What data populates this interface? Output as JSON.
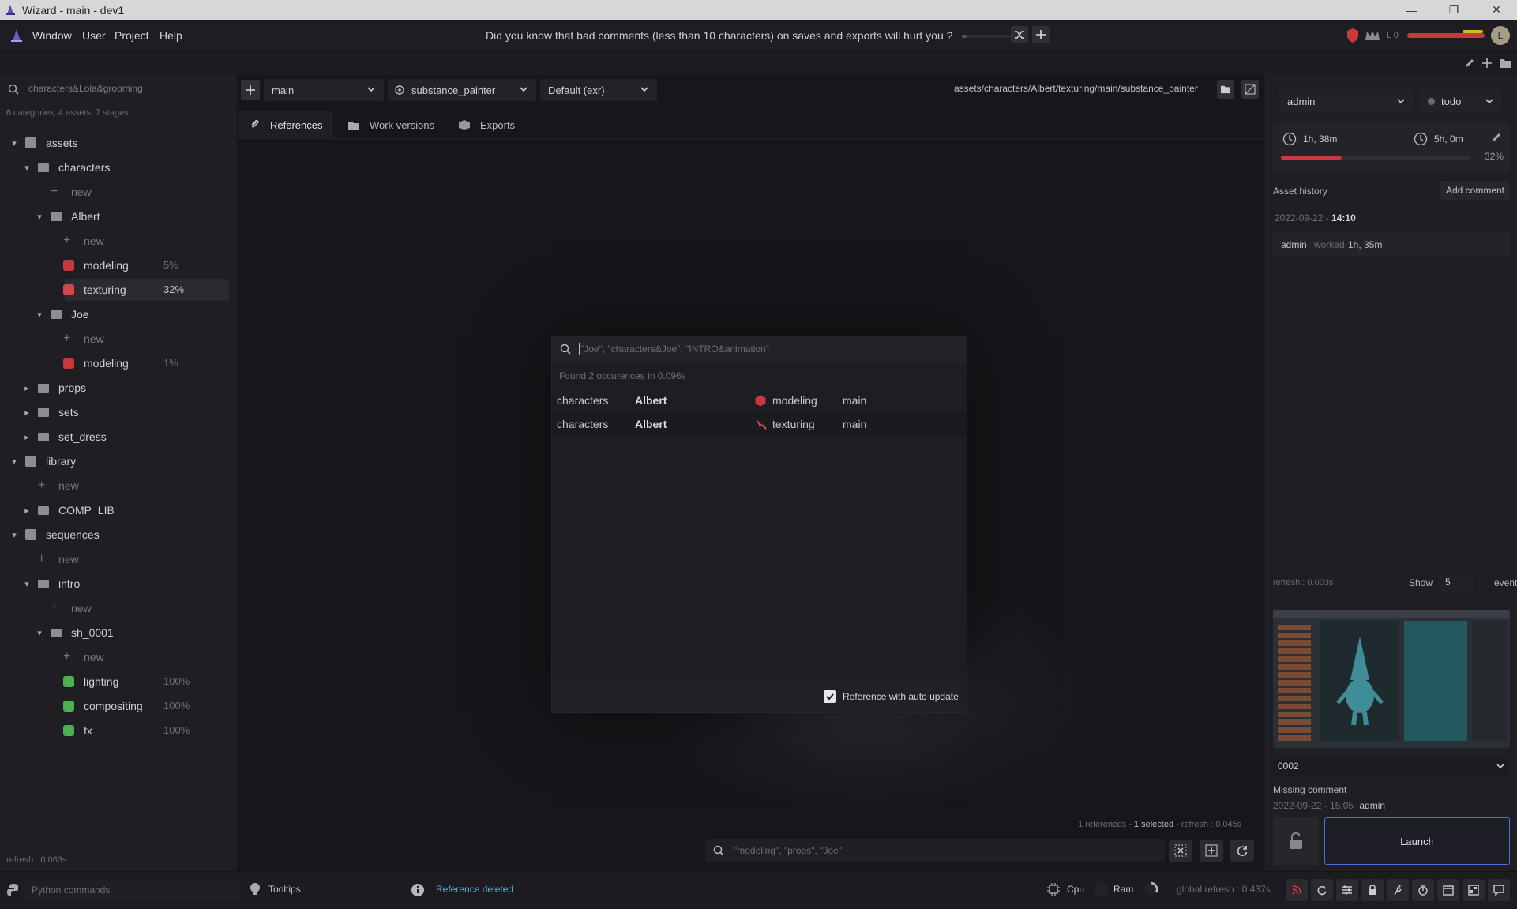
{
  "window": {
    "title": "Wizard - main - dev1",
    "minimize": "—",
    "maximize": "❐",
    "close": "✕"
  },
  "menu": {
    "items": [
      "Window",
      "User",
      "Project",
      "Help"
    ],
    "tip": "Did you know that bad comments (less than 10 characters) on saves and exports will hurt you ?",
    "level_label": "L 0",
    "avatar_letter": "L"
  },
  "left": {
    "search_value": "characters&Lola&grooming",
    "summary": "6 categories, 4 assets, 7 stages",
    "refresh": "refresh : 0.063s",
    "tree": [
      {
        "label": "assets",
        "depth": 0,
        "kind": "category",
        "open": true
      },
      {
        "label": "characters",
        "depth": 1,
        "kind": "folder",
        "open": true
      },
      {
        "label": "new",
        "depth": 2,
        "kind": "new"
      },
      {
        "label": "Albert",
        "depth": 2,
        "kind": "folder",
        "open": true
      },
      {
        "label": "new",
        "depth": 3,
        "kind": "new"
      },
      {
        "label": "modeling",
        "depth": 3,
        "kind": "stage",
        "pct": "5%",
        "color": "#c8383c"
      },
      {
        "label": "texturing",
        "depth": 3,
        "kind": "stage",
        "pct": "32%",
        "color": "#d0484a",
        "selected": true
      },
      {
        "label": "Joe",
        "depth": 2,
        "kind": "folder",
        "open": true
      },
      {
        "label": "new",
        "depth": 3,
        "kind": "new"
      },
      {
        "label": "modeling",
        "depth": 3,
        "kind": "stage",
        "pct": "1%",
        "color": "#c8383c"
      },
      {
        "label": "props",
        "depth": 1,
        "kind": "folder",
        "open": false
      },
      {
        "label": "sets",
        "depth": 1,
        "kind": "folder",
        "open": false
      },
      {
        "label": "set_dress",
        "depth": 1,
        "kind": "folder",
        "open": false
      },
      {
        "label": "library",
        "depth": 0,
        "kind": "category",
        "open": true
      },
      {
        "label": "new",
        "depth": 1,
        "kind": "new"
      },
      {
        "label": "COMP_LIB",
        "depth": 1,
        "kind": "folder",
        "open": false
      },
      {
        "label": "sequences",
        "depth": 0,
        "kind": "category",
        "open": true
      },
      {
        "label": "new",
        "depth": 1,
        "kind": "new"
      },
      {
        "label": "intro",
        "depth": 1,
        "kind": "folder",
        "open": true
      },
      {
        "label": "new",
        "depth": 2,
        "kind": "new"
      },
      {
        "label": "sh_0001",
        "depth": 2,
        "kind": "folder",
        "open": true
      },
      {
        "label": "new",
        "depth": 3,
        "kind": "new"
      },
      {
        "label": "lighting",
        "depth": 3,
        "kind": "stage",
        "pct": "100%",
        "color": "#4caf50"
      },
      {
        "label": "compositing",
        "depth": 3,
        "kind": "stage",
        "pct": "100%",
        "color": "#4caf50"
      },
      {
        "label": "fx",
        "depth": 3,
        "kind": "stage",
        "pct": "100%",
        "color": "#4caf50"
      }
    ]
  },
  "center": {
    "variant": "main",
    "software": "substance_painter",
    "export_format": "Default (exr)",
    "path": "assets/characters/Albert/texturing/main/substance_painter",
    "tabs": [
      "References",
      "Work versions",
      "Exports"
    ],
    "footer_refs": "1 references - ",
    "footer_selected": "1 selected",
    "footer_refresh": " - refresh : 0.045s",
    "bottom_search_placeholder": "\"modeling\", \"props\", \"Joe\""
  },
  "popup": {
    "search_placeholder": "\"Joe\", \"characters&Joe\", \"INTRO&animation\"",
    "found": "Found 2 occurences in 0.096s",
    "results": [
      {
        "category": "characters",
        "asset": "Albert",
        "stage": "modeling",
        "variant": "main",
        "color": "#c8383c"
      },
      {
        "category": "characters",
        "asset": "Albert",
        "stage": "texturing",
        "variant": "main",
        "color": "#d0484a"
      }
    ],
    "auto_update_label": "Reference with auto update",
    "auto_update_checked": true
  },
  "right": {
    "user": "admin",
    "state": "todo",
    "time_spent": "1h, 38m",
    "estimated": "5h, 0m",
    "progress_percent": 32,
    "progress_label": "32%",
    "history_title": "Asset history",
    "add_comment": "Add comment",
    "history_date": "2022-09-22 - ",
    "history_time": "14:10",
    "history_user": "admin",
    "history_action": "worked",
    "history_duration": "1h, 35m",
    "refresh": "refresh : 0.003s",
    "show_label": "Show",
    "show_count": "5",
    "events_label": "events",
    "version": "0002",
    "missing_comment": "Missing comment",
    "version_date": "2022-09-22 - 15:05",
    "version_user": "admin",
    "launch": "Launch"
  },
  "status": {
    "python_placeholder": "Python commands",
    "tooltips": "Tooltips",
    "message": "Reference deleted",
    "cpu": "Cpu",
    "ram": "Ram",
    "global_refresh": "global refresh : 0.437s"
  },
  "colors": {
    "accent": "#4a6fd6",
    "danger": "#c8383c",
    "success": "#4caf50",
    "info": "#5fb3c9"
  }
}
